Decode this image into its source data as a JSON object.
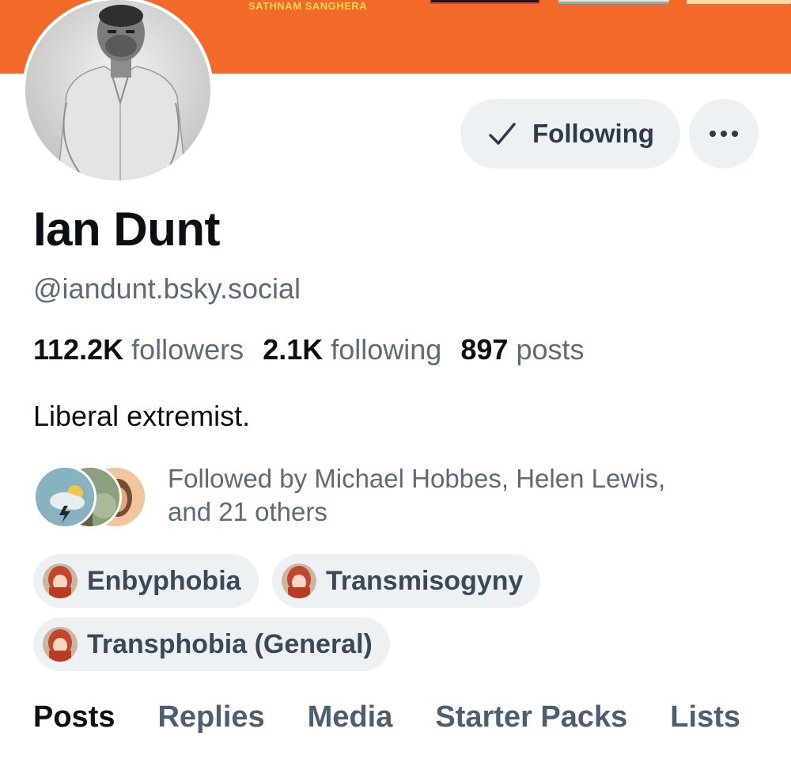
{
  "banner": {
    "author_text": "SATHNAM SANGHERA",
    "color": "#f26a2a"
  },
  "profile": {
    "display_name": "Ian Dunt",
    "handle": "@iandunt.bsky.social",
    "bio": "Liberal extremist."
  },
  "actions": {
    "following_label": "Following",
    "following_icon": "check-icon",
    "more_icon": "ellipsis-icon"
  },
  "stats": {
    "followers_count": "112.2K",
    "followers_label": "followers",
    "following_count": "2.1K",
    "following_label": "following",
    "posts_count": "897",
    "posts_label": "posts"
  },
  "followed_by": {
    "line1": "Followed by Michael Hobbes, Helen Lewis,",
    "line2": "and 21 others"
  },
  "labels": [
    {
      "text": "Enbyphobia",
      "icon": "anime-avatar-icon"
    },
    {
      "text": "Transmisogyny",
      "icon": "anime-avatar-icon"
    },
    {
      "text": "Transphobia (General)",
      "icon": "anime-avatar-icon"
    }
  ],
  "tabs": [
    {
      "label": "Posts",
      "active": true
    },
    {
      "label": "Replies",
      "active": false
    },
    {
      "label": "Media",
      "active": false
    },
    {
      "label": "Starter Packs",
      "active": false
    },
    {
      "label": "Lists",
      "active": false
    }
  ],
  "colors": {
    "text_primary": "#0b0f14",
    "text_secondary": "#5b6b7c",
    "chip_bg": "#eef1f4"
  }
}
